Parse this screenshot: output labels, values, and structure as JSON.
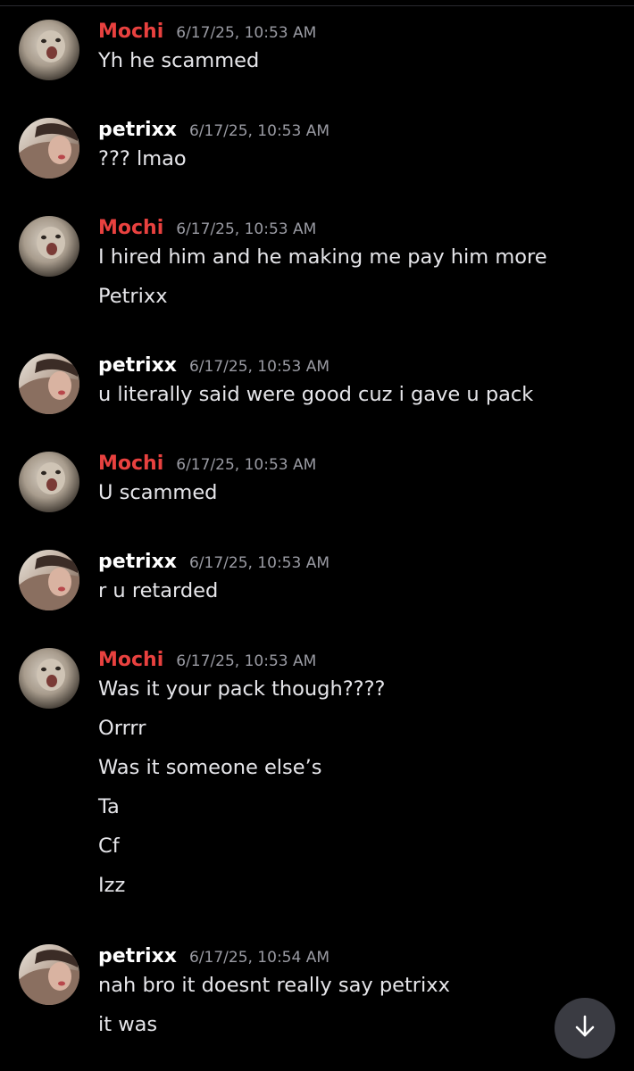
{
  "colors": {
    "background": "#000000",
    "mochi": "#e8413f",
    "petrixx": "#ffffff",
    "timestamp": "#9a9ba3",
    "message_text": "#e6e6ea",
    "scroll_button": "#3a3b42"
  },
  "messages": [
    {
      "author": "Mochi",
      "time": "6/17/25, 10:53 AM",
      "lines": [
        "Yh he scammed"
      ]
    },
    {
      "author": "petrixx",
      "time": "6/17/25, 10:53 AM",
      "lines": [
        "??? lmao"
      ]
    },
    {
      "author": "Mochi",
      "time": "6/17/25, 10:53 AM",
      "lines": [
        "I hired him and he making me pay him more",
        "Petrixx"
      ]
    },
    {
      "author": "petrixx",
      "time": "6/17/25, 10:53 AM",
      "lines": [
        "u literally said were good cuz i gave u pack"
      ]
    },
    {
      "author": "Mochi",
      "time": "6/17/25, 10:53 AM",
      "lines": [
        "U scammed"
      ]
    },
    {
      "author": "petrixx",
      "time": "6/17/25, 10:53 AM",
      "lines": [
        "r u retarded"
      ]
    },
    {
      "author": "Mochi",
      "time": "6/17/25, 10:53 AM",
      "lines": [
        "Was it your pack though????",
        "Orrrr",
        "Was it someone else’s",
        "Ta",
        "Cf",
        "Izz"
      ]
    },
    {
      "author": "petrixx",
      "time": "6/17/25, 10:54 AM",
      "lines": [
        "nah bro it doesnt really say petrixx",
        "it was"
      ]
    }
  ],
  "scroll_button": {
    "icon": "arrow-down-icon"
  }
}
